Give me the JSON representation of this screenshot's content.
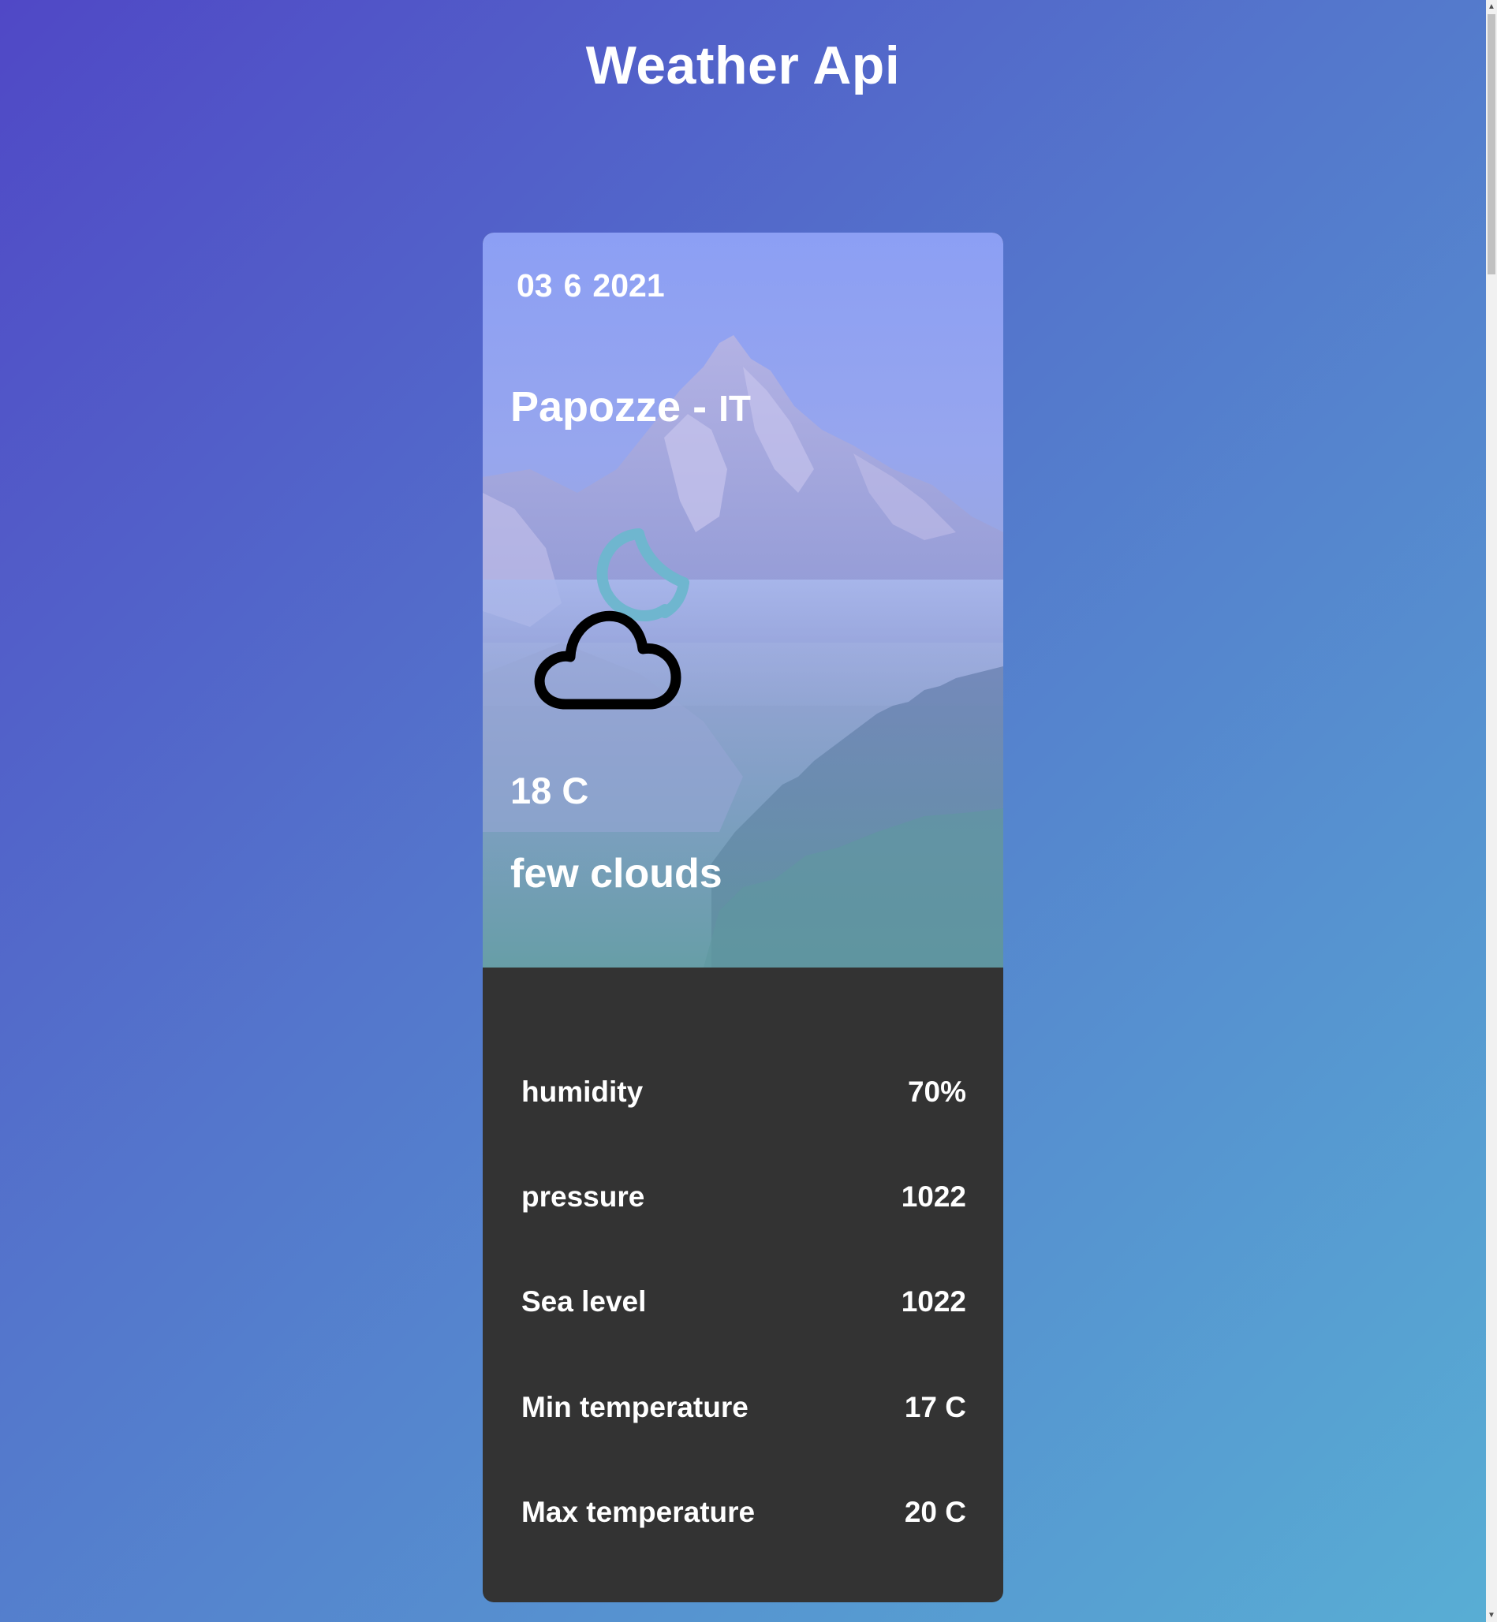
{
  "header": {
    "title": "Weather Api"
  },
  "card": {
    "date": {
      "day": "03",
      "month": "6",
      "year": "2021"
    },
    "city": "Papozze",
    "separator": "-",
    "country": "IT",
    "icon": "cloud-with-moon-icon",
    "temperature": "18 C",
    "description": "few clouds"
  },
  "details": [
    {
      "label": "humidity",
      "value": "70%"
    },
    {
      "label": "pressure",
      "value": "1022"
    },
    {
      "label": "Sea level",
      "value": "1022"
    },
    {
      "label": "Min temperature",
      "value": "17 C"
    },
    {
      "label": "Max temperature",
      "value": "20 C"
    }
  ],
  "colors": {
    "background_start": "#5048c6",
    "background_end": "#58aed4",
    "details_panel": "#333333",
    "moon_icon": "#6fb6cf",
    "text": "#ffffff"
  }
}
